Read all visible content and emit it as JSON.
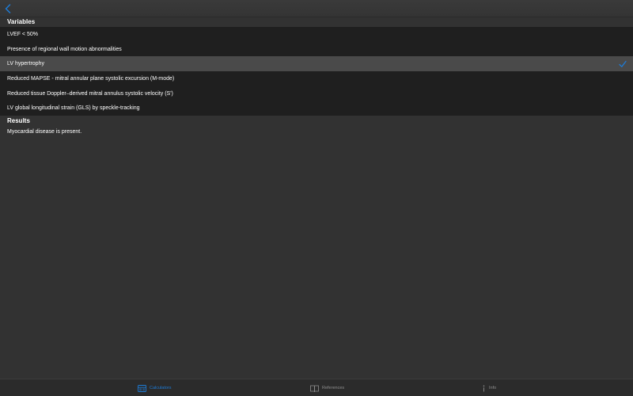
{
  "nav": {
    "back_icon": "chevron-left-icon"
  },
  "variables": {
    "header": "Variables",
    "items": [
      {
        "label": "LVEF < 50%",
        "selected": false
      },
      {
        "label": "Presence of regional wall motion abnormalities",
        "selected": false
      },
      {
        "label": "LV hypertrophy",
        "selected": true
      },
      {
        "label": "Reduced MAPSE - mitral annular plane systolic excursion (M-mode)",
        "selected": false
      },
      {
        "label": "Reduced tissue Doppler–derived mitral annulus systolic velocity (S')",
        "selected": false
      },
      {
        "label": "LV global longitudinal strain (GLS) by speckle-tracking",
        "selected": false
      }
    ]
  },
  "results": {
    "header": "Results",
    "text": "Myocardial disease is present."
  },
  "tabs": [
    {
      "label": "Calculators",
      "icon": "calculator-icon",
      "active": true
    },
    {
      "label": "References",
      "icon": "book-icon",
      "active": false
    },
    {
      "label": "Info",
      "icon": "info-icon",
      "active": false
    }
  ],
  "colors": {
    "accent": "#1e7bd6",
    "background": "#323232",
    "row": "#1f1f1f",
    "selected_row": "#4a4a4a"
  }
}
